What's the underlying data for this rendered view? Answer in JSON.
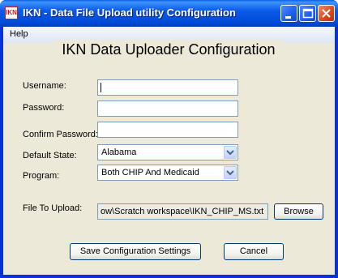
{
  "window": {
    "title": "IKN - Data File Upload utility Configuration",
    "icon_text": "IKN"
  },
  "menu": {
    "help": "Help"
  },
  "form": {
    "heading": "IKN Data Uploader Configuration",
    "username_label": "Username:",
    "username_value": "",
    "password_label": "Password:",
    "password_value": "",
    "confirm_label": "Confirm Password:",
    "confirm_value": "",
    "state_label": "Default State:",
    "state_value": "Alabama",
    "program_label": "Program:",
    "program_value": "Both CHIP And Medicaid",
    "file_label": "File To Upload:",
    "file_value": "ow\\Scratch workspace\\IKN_CHIP_MS.txt",
    "browse_label": "Browse"
  },
  "actions": {
    "save_label": "Save Configuration Settings",
    "cancel_label": "Cancel"
  },
  "colors": {
    "titlebar": "#0054e3",
    "client_bg": "#ece9d8",
    "close_button": "#e04a21",
    "field_border": "#7f9db9"
  }
}
